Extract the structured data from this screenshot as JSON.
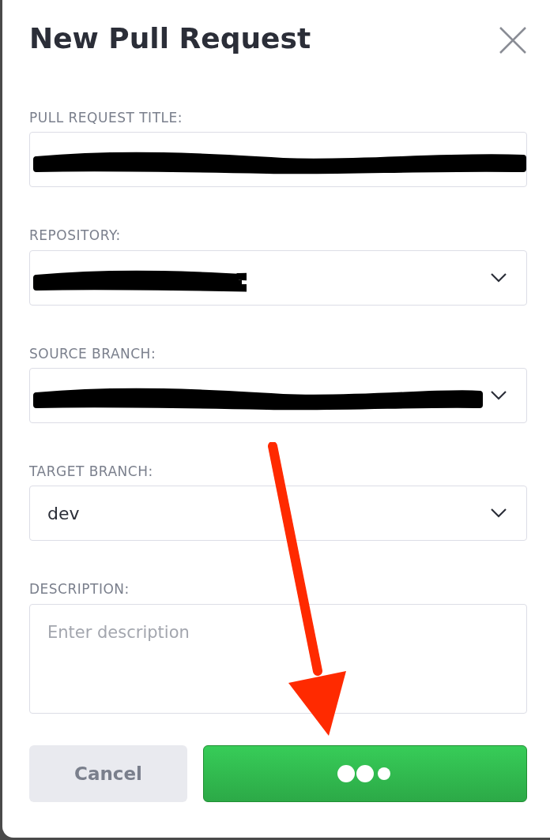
{
  "dialog": {
    "title": "New Pull Request"
  },
  "fields": [
    {
      "kind": "text",
      "label": "PULL REQUEST TITLE:",
      "redacted": true
    },
    {
      "kind": "select",
      "label": "REPOSITORY:",
      "redacted": true
    },
    {
      "kind": "select",
      "label": "SOURCE BRANCH:",
      "redacted": true
    },
    {
      "kind": "select",
      "label": "TARGET BRANCH:",
      "value": "dev",
      "redacted": false
    },
    {
      "kind": "textarea",
      "label": "DESCRIPTION:",
      "placeholder": "Enter description"
    }
  ],
  "buttons": [
    {
      "kind": "secondary",
      "label": "Cancel"
    },
    {
      "kind": "primary",
      "loading": true
    }
  ],
  "annotations": [
    {
      "kind": "arrow"
    }
  ]
}
